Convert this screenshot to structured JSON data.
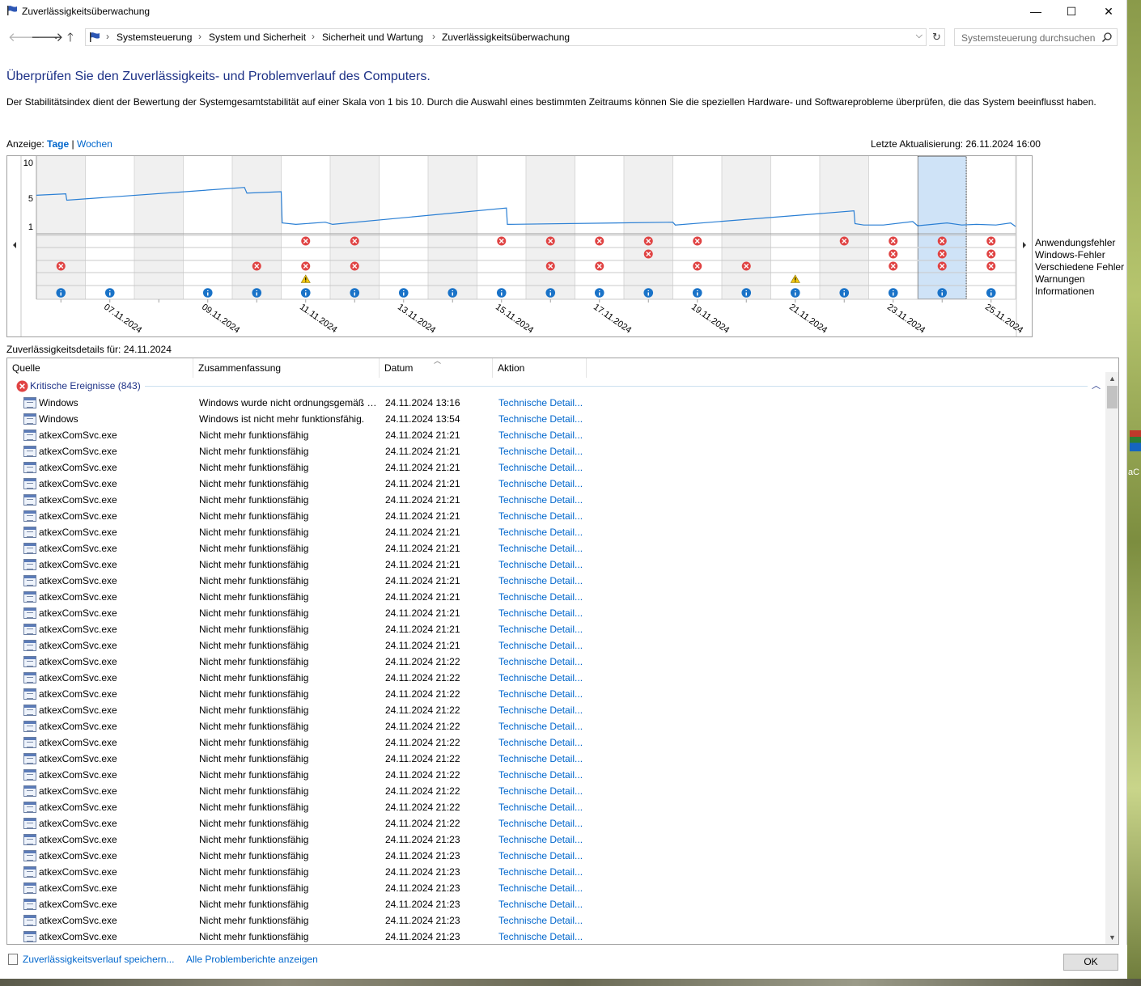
{
  "window": {
    "title": "Zuverlässigkeitsüberwachung",
    "minimize_glyph": "—",
    "maximize_glyph": "☐",
    "close_glyph": "✕"
  },
  "nav": {
    "breadcrumbs": [
      "Systemsteuerung",
      "System und Sicherheit",
      "Sicherheit und Wartung",
      "Zuverlässigkeitsüberwachung"
    ],
    "search_placeholder": "Systemsteuerung durchsuchen"
  },
  "header": {
    "title": "Überprüfen Sie den Zuverlässigkeits- und Problemverlauf des Computers.",
    "description": "Der Stabilitätsindex dient der Bewertung der Systemgesamtstabilität auf einer Skala von 1 bis 10. Durch die Auswahl eines bestimmten Zeitraums können Sie die speziellen Hardware- und Softwareprobleme überprüfen, die das System beeinflusst haben."
  },
  "view": {
    "label": "Anzeige:",
    "days": "Tage",
    "separator": "|",
    "weeks": "Wochen",
    "last_update": "Letzte Aktualisierung: 26.11.2024 16:00"
  },
  "chart_data": {
    "type": "line",
    "y_ticks": [
      "10",
      "5",
      "1"
    ],
    "ylim": [
      1,
      10
    ],
    "x_labels": [
      "07.11.2024",
      "09.11.2024",
      "11.11.2024",
      "13.11.2024",
      "15.11.2024",
      "17.11.2024",
      "19.11.2024",
      "21.11.2024",
      "23.11.2024",
      "25.11.2024"
    ],
    "days": [
      "06.11.2024",
      "07.11.2024",
      "08.11.2024",
      "09.11.2024",
      "10.11.2024",
      "11.11.2024",
      "12.11.2024",
      "13.11.2024",
      "14.11.2024",
      "15.11.2024",
      "16.11.2024",
      "17.11.2024",
      "18.11.2024",
      "19.11.2024",
      "20.11.2024",
      "21.11.2024",
      "22.11.2024",
      "23.11.2024",
      "24.11.2024",
      "25.11.2024"
    ],
    "selected_day": "24.11.2024",
    "stability_index": [
      [
        0,
        5.4
      ],
      [
        0.6,
        5.6
      ],
      [
        0.62,
        4.7
      ],
      [
        4.25,
        6.5
      ],
      [
        4.3,
        5.7
      ],
      [
        5.0,
        5.9
      ],
      [
        5.02,
        1.5
      ],
      [
        5.3,
        1.3
      ],
      [
        5.9,
        1.6
      ],
      [
        6.05,
        1.3
      ],
      [
        9.6,
        3.6
      ],
      [
        9.62,
        1.3
      ],
      [
        13.0,
        1.6
      ],
      [
        13.05,
        1.2
      ],
      [
        16.7,
        3.2
      ],
      [
        16.72,
        1.4
      ],
      [
        16.9,
        1.2
      ],
      [
        17.3,
        1.2
      ],
      [
        17.9,
        1.7
      ],
      [
        18.0,
        1.1
      ],
      [
        18.6,
        1.5
      ],
      [
        18.9,
        1.2
      ],
      [
        19.2,
        1.3
      ],
      [
        19.6,
        1.2
      ],
      [
        19.9,
        1.5
      ],
      [
        20.0,
        1.0
      ]
    ],
    "rows": [
      "Anwendungsfehler",
      "Windows-Fehler",
      "Verschiedene Fehler",
      "Warnungen",
      "Informationen"
    ],
    "events": {
      "Anwendungsfehler": [
        5,
        6,
        9,
        10,
        11,
        12,
        13,
        16,
        17,
        18,
        19
      ],
      "Windows-Fehler": [
        12,
        17,
        18,
        19
      ],
      "Verschiedene Fehler": [
        0,
        4,
        5,
        6,
        10,
        11,
        13,
        14,
        17,
        18,
        19
      ],
      "Warnungen": [
        5,
        15
      ],
      "Informationen": [
        0,
        1,
        3,
        4,
        5,
        6,
        7,
        8,
        9,
        10,
        11,
        12,
        13,
        14,
        15,
        16,
        17,
        18,
        19
      ]
    },
    "colors": {
      "line": "#2a7fd4",
      "error": "#e04343",
      "warning": "#f2c811",
      "info": "#1a73c8",
      "selected": "#cfe3f7",
      "shaded": "#f0f0f0"
    }
  },
  "legend": [
    "Anwendungsfehler",
    "Windows-Fehler",
    "Verschiedene Fehler",
    "Warnungen",
    "Informationen"
  ],
  "details": {
    "label": "Zuverlässigkeitsdetails für: 24.11.2024",
    "columns": [
      "Quelle",
      "Zusammenfassung",
      "Datum",
      "Aktion"
    ],
    "group": "Kritische Ereignisse (843)",
    "rows": [
      {
        "source": "Windows",
        "summary": "Windows wurde nicht ordnungsgemäß heruntergefahren",
        "date": "24.11.2024 13:16",
        "action": "Technische Detail..."
      },
      {
        "source": "Windows",
        "summary": "Windows ist nicht mehr funktionsfähig.",
        "date": "24.11.2024 13:54",
        "action": "Technische Detail..."
      },
      {
        "source": "atkexComSvc.exe",
        "summary": "Nicht mehr funktionsfähig",
        "date": "24.11.2024 21:21",
        "action": "Technische Detail..."
      },
      {
        "source": "atkexComSvc.exe",
        "summary": "Nicht mehr funktionsfähig",
        "date": "24.11.2024 21:21",
        "action": "Technische Detail..."
      },
      {
        "source": "atkexComSvc.exe",
        "summary": "Nicht mehr funktionsfähig",
        "date": "24.11.2024 21:21",
        "action": "Technische Detail..."
      },
      {
        "source": "atkexComSvc.exe",
        "summary": "Nicht mehr funktionsfähig",
        "date": "24.11.2024 21:21",
        "action": "Technische Detail..."
      },
      {
        "source": "atkexComSvc.exe",
        "summary": "Nicht mehr funktionsfähig",
        "date": "24.11.2024 21:21",
        "action": "Technische Detail..."
      },
      {
        "source": "atkexComSvc.exe",
        "summary": "Nicht mehr funktionsfähig",
        "date": "24.11.2024 21:21",
        "action": "Technische Detail..."
      },
      {
        "source": "atkexComSvc.exe",
        "summary": "Nicht mehr funktionsfähig",
        "date": "24.11.2024 21:21",
        "action": "Technische Detail..."
      },
      {
        "source": "atkexComSvc.exe",
        "summary": "Nicht mehr funktionsfähig",
        "date": "24.11.2024 21:21",
        "action": "Technische Detail..."
      },
      {
        "source": "atkexComSvc.exe",
        "summary": "Nicht mehr funktionsfähig",
        "date": "24.11.2024 21:21",
        "action": "Technische Detail..."
      },
      {
        "source": "atkexComSvc.exe",
        "summary": "Nicht mehr funktionsfähig",
        "date": "24.11.2024 21:21",
        "action": "Technische Detail..."
      },
      {
        "source": "atkexComSvc.exe",
        "summary": "Nicht mehr funktionsfähig",
        "date": "24.11.2024 21:21",
        "action": "Technische Detail..."
      },
      {
        "source": "atkexComSvc.exe",
        "summary": "Nicht mehr funktionsfähig",
        "date": "24.11.2024 21:21",
        "action": "Technische Detail..."
      },
      {
        "source": "atkexComSvc.exe",
        "summary": "Nicht mehr funktionsfähig",
        "date": "24.11.2024 21:21",
        "action": "Technische Detail..."
      },
      {
        "source": "atkexComSvc.exe",
        "summary": "Nicht mehr funktionsfähig",
        "date": "24.11.2024 21:21",
        "action": "Technische Detail..."
      },
      {
        "source": "atkexComSvc.exe",
        "summary": "Nicht mehr funktionsfähig",
        "date": "24.11.2024 21:22",
        "action": "Technische Detail..."
      },
      {
        "source": "atkexComSvc.exe",
        "summary": "Nicht mehr funktionsfähig",
        "date": "24.11.2024 21:22",
        "action": "Technische Detail..."
      },
      {
        "source": "atkexComSvc.exe",
        "summary": "Nicht mehr funktionsfähig",
        "date": "24.11.2024 21:22",
        "action": "Technische Detail..."
      },
      {
        "source": "atkexComSvc.exe",
        "summary": "Nicht mehr funktionsfähig",
        "date": "24.11.2024 21:22",
        "action": "Technische Detail..."
      },
      {
        "source": "atkexComSvc.exe",
        "summary": "Nicht mehr funktionsfähig",
        "date": "24.11.2024 21:22",
        "action": "Technische Detail..."
      },
      {
        "source": "atkexComSvc.exe",
        "summary": "Nicht mehr funktionsfähig",
        "date": "24.11.2024 21:22",
        "action": "Technische Detail..."
      },
      {
        "source": "atkexComSvc.exe",
        "summary": "Nicht mehr funktionsfähig",
        "date": "24.11.2024 21:22",
        "action": "Technische Detail..."
      },
      {
        "source": "atkexComSvc.exe",
        "summary": "Nicht mehr funktionsfähig",
        "date": "24.11.2024 21:22",
        "action": "Technische Detail..."
      },
      {
        "source": "atkexComSvc.exe",
        "summary": "Nicht mehr funktionsfähig",
        "date": "24.11.2024 21:22",
        "action": "Technische Detail..."
      },
      {
        "source": "atkexComSvc.exe",
        "summary": "Nicht mehr funktionsfähig",
        "date": "24.11.2024 21:22",
        "action": "Technische Detail..."
      },
      {
        "source": "atkexComSvc.exe",
        "summary": "Nicht mehr funktionsfähig",
        "date": "24.11.2024 21:22",
        "action": "Technische Detail..."
      },
      {
        "source": "atkexComSvc.exe",
        "summary": "Nicht mehr funktionsfähig",
        "date": "24.11.2024 21:23",
        "action": "Technische Detail..."
      },
      {
        "source": "atkexComSvc.exe",
        "summary": "Nicht mehr funktionsfähig",
        "date": "24.11.2024 21:23",
        "action": "Technische Detail..."
      },
      {
        "source": "atkexComSvc.exe",
        "summary": "Nicht mehr funktionsfähig",
        "date": "24.11.2024 21:23",
        "action": "Technische Detail..."
      },
      {
        "source": "atkexComSvc.exe",
        "summary": "Nicht mehr funktionsfähig",
        "date": "24.11.2024 21:23",
        "action": "Technische Detail..."
      },
      {
        "source": "atkexComSvc.exe",
        "summary": "Nicht mehr funktionsfähig",
        "date": "24.11.2024 21:23",
        "action": "Technische Detail..."
      },
      {
        "source": "atkexComSvc.exe",
        "summary": "Nicht mehr funktionsfähig",
        "date": "24.11.2024 21:23",
        "action": "Technische Detail..."
      },
      {
        "source": "atkexComSvc.exe",
        "summary": "Nicht mehr funktionsfähig",
        "date": "24.11.2024 21:23",
        "action": "Technische Detail..."
      }
    ]
  },
  "footer": {
    "save_link": "Zuverlässigkeitsverlauf speichern...",
    "all_reports_link": "Alle Problemberichte anzeigen",
    "ok": "OK"
  },
  "desktop": {
    "label": "aC"
  }
}
